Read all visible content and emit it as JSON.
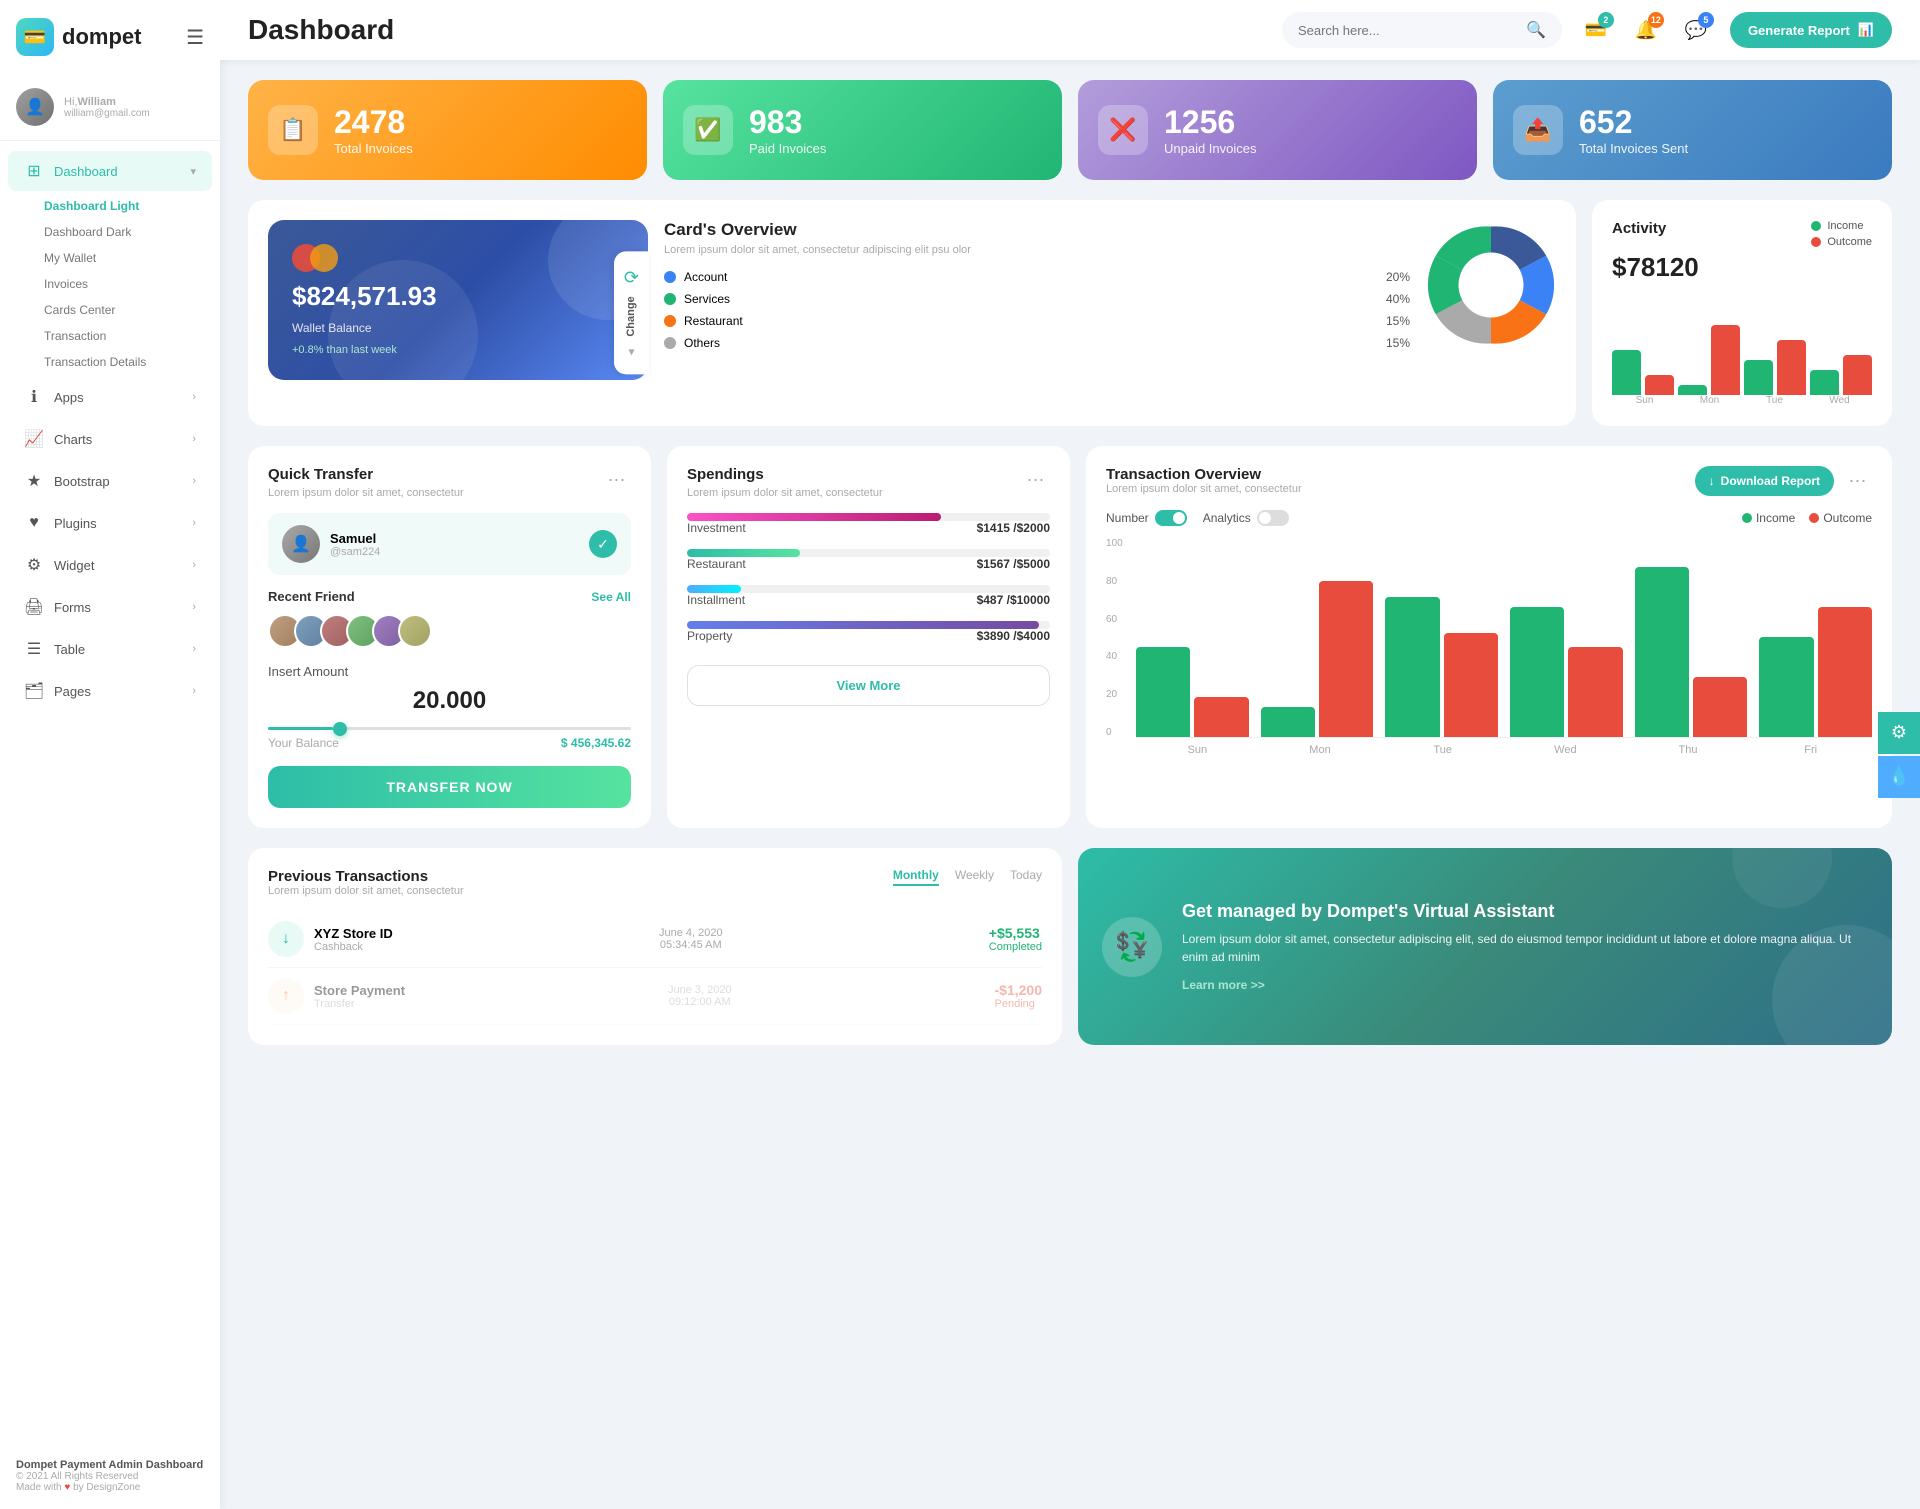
{
  "app": {
    "name": "dompet",
    "title": "Dashboard"
  },
  "header": {
    "search_placeholder": "Search here...",
    "generate_btn": "Generate Report",
    "badge_wallet": "2",
    "badge_bell": "12",
    "badge_chat": "5"
  },
  "user": {
    "greeting": "Hi,",
    "name": "William",
    "email": "william@gmail.com"
  },
  "nav": {
    "dashboard": "Dashboard",
    "sub_items": [
      "Dashboard Light",
      "Dashboard Dark",
      "My Wallet",
      "Invoices",
      "Cards Center",
      "Transaction",
      "Transaction Details"
    ],
    "apps": "Apps",
    "charts": "Charts",
    "bootstrap": "Bootstrap",
    "plugins": "Plugins",
    "widget": "Widget",
    "forms": "Forms",
    "table": "Table",
    "pages": "Pages"
  },
  "footer": {
    "brand": "Dompet Payment Admin Dashboard",
    "copy": "© 2021 All Rights Reserved",
    "made": "Made with",
    "by": "by DesignZone"
  },
  "stats": [
    {
      "num": "2478",
      "label": "Total Invoices",
      "icon": "📋"
    },
    {
      "num": "983",
      "label": "Paid Invoices",
      "icon": "✅"
    },
    {
      "num": "1256",
      "label": "Unpaid Invoices",
      "icon": "❌"
    },
    {
      "num": "652",
      "label": "Total Invoices Sent",
      "icon": "📤"
    }
  ],
  "wallet": {
    "amount": "$824,571.93",
    "label": "Wallet Balance",
    "change": "+0.8% than last week",
    "change_btn": "Change"
  },
  "overview": {
    "title": "Card's Overview",
    "sub": "Lorem ipsum dolor sit amet, consectetur adipiscing elit psu olor",
    "items": [
      {
        "name": "Account",
        "pct": "20%",
        "color": "blue"
      },
      {
        "name": "Services",
        "pct": "40%",
        "color": "green"
      },
      {
        "name": "Restaurant",
        "pct": "15%",
        "color": "orange"
      },
      {
        "name": "Others",
        "pct": "15%",
        "color": "gray"
      }
    ]
  },
  "activity": {
    "title": "Activity",
    "amount": "$78120",
    "income_label": "Income",
    "outcome_label": "Outcome",
    "bars": {
      "sun": {
        "income": 45,
        "outcome": 20
      },
      "mon": {
        "income": 10,
        "outcome": 70
      },
      "tue": {
        "income": 35,
        "outcome": 55
      },
      "wed": {
        "income": 25,
        "outcome": 40
      }
    },
    "labels": [
      "Sun",
      "Mon",
      "Tue",
      "Wed"
    ]
  },
  "quick_transfer": {
    "title": "Quick Transfer",
    "sub": "Lorem ipsum dolor sit amet, consectetur",
    "user_name": "Samuel",
    "user_handle": "@sam224",
    "recent_label": "Recent Friend",
    "see_all": "See All",
    "insert_label": "Insert Amount",
    "amount": "20.000",
    "balance_label": "Your Balance",
    "balance_val": "$ 456,345.62",
    "btn": "TRANSFER NOW"
  },
  "spendings": {
    "title": "Spendings",
    "sub": "Lorem ipsum dolor sit amet, consectetur",
    "items": [
      {
        "name": "Investment",
        "val": "$1415",
        "max": "$2000",
        "pct": 70,
        "color": "pink"
      },
      {
        "name": "Restaurant",
        "val": "$1567",
        "max": "$5000",
        "pct": 31,
        "color": "teal"
      },
      {
        "name": "Installment",
        "val": "$487",
        "max": "$10000",
        "pct": 15,
        "color": "blue"
      },
      {
        "name": "Property",
        "val": "$3890",
        "max": "$4000",
        "pct": 97,
        "color": "purple"
      }
    ],
    "view_more": "View More"
  },
  "txn_overview": {
    "title": "Transaction Overview",
    "sub": "Lorem ipsum dolor sit amet, consectetur",
    "download_btn": "Download Report",
    "number_label": "Number",
    "analytics_label": "Analytics",
    "income_label": "Income",
    "outcome_label": "Outcome",
    "y_labels": [
      "100",
      "80",
      "60",
      "40",
      "20",
      "0"
    ],
    "x_labels": [
      "Sun",
      "Mon",
      "Tue",
      "Wed",
      "Thu",
      "Fri"
    ],
    "bars": {
      "sun": {
        "income": 45,
        "outcome": 20
      },
      "mon": {
        "income": 15,
        "outcome": 78
      },
      "tue": {
        "income": 70,
        "outcome": 52
      },
      "wed": {
        "income": 65,
        "outcome": 45
      },
      "thu": {
        "income": 85,
        "outcome": 30
      },
      "fri": {
        "income": 50,
        "outcome": 65
      }
    }
  },
  "prev_transactions": {
    "title": "Previous Transactions",
    "sub": "Lorem ipsum dolor sit amet, consectetur",
    "tabs": [
      "Monthly",
      "Weekly",
      "Today"
    ],
    "items": [
      {
        "name": "XYZ Store ID",
        "type": "Cashback",
        "date": "June 4, 2020",
        "time": "05:34:45 AM",
        "amount": "+$5,553",
        "status": "Completed"
      }
    ]
  },
  "va": {
    "title": "Get managed by Dompet's Virtual Assistant",
    "text": "Lorem ipsum dolor sit amet, consectetur adipiscing elit, sed do eiusmod tempor incididunt ut labore et dolore magna aliqua. Ut enim ad minim",
    "link": "Learn more >>"
  }
}
